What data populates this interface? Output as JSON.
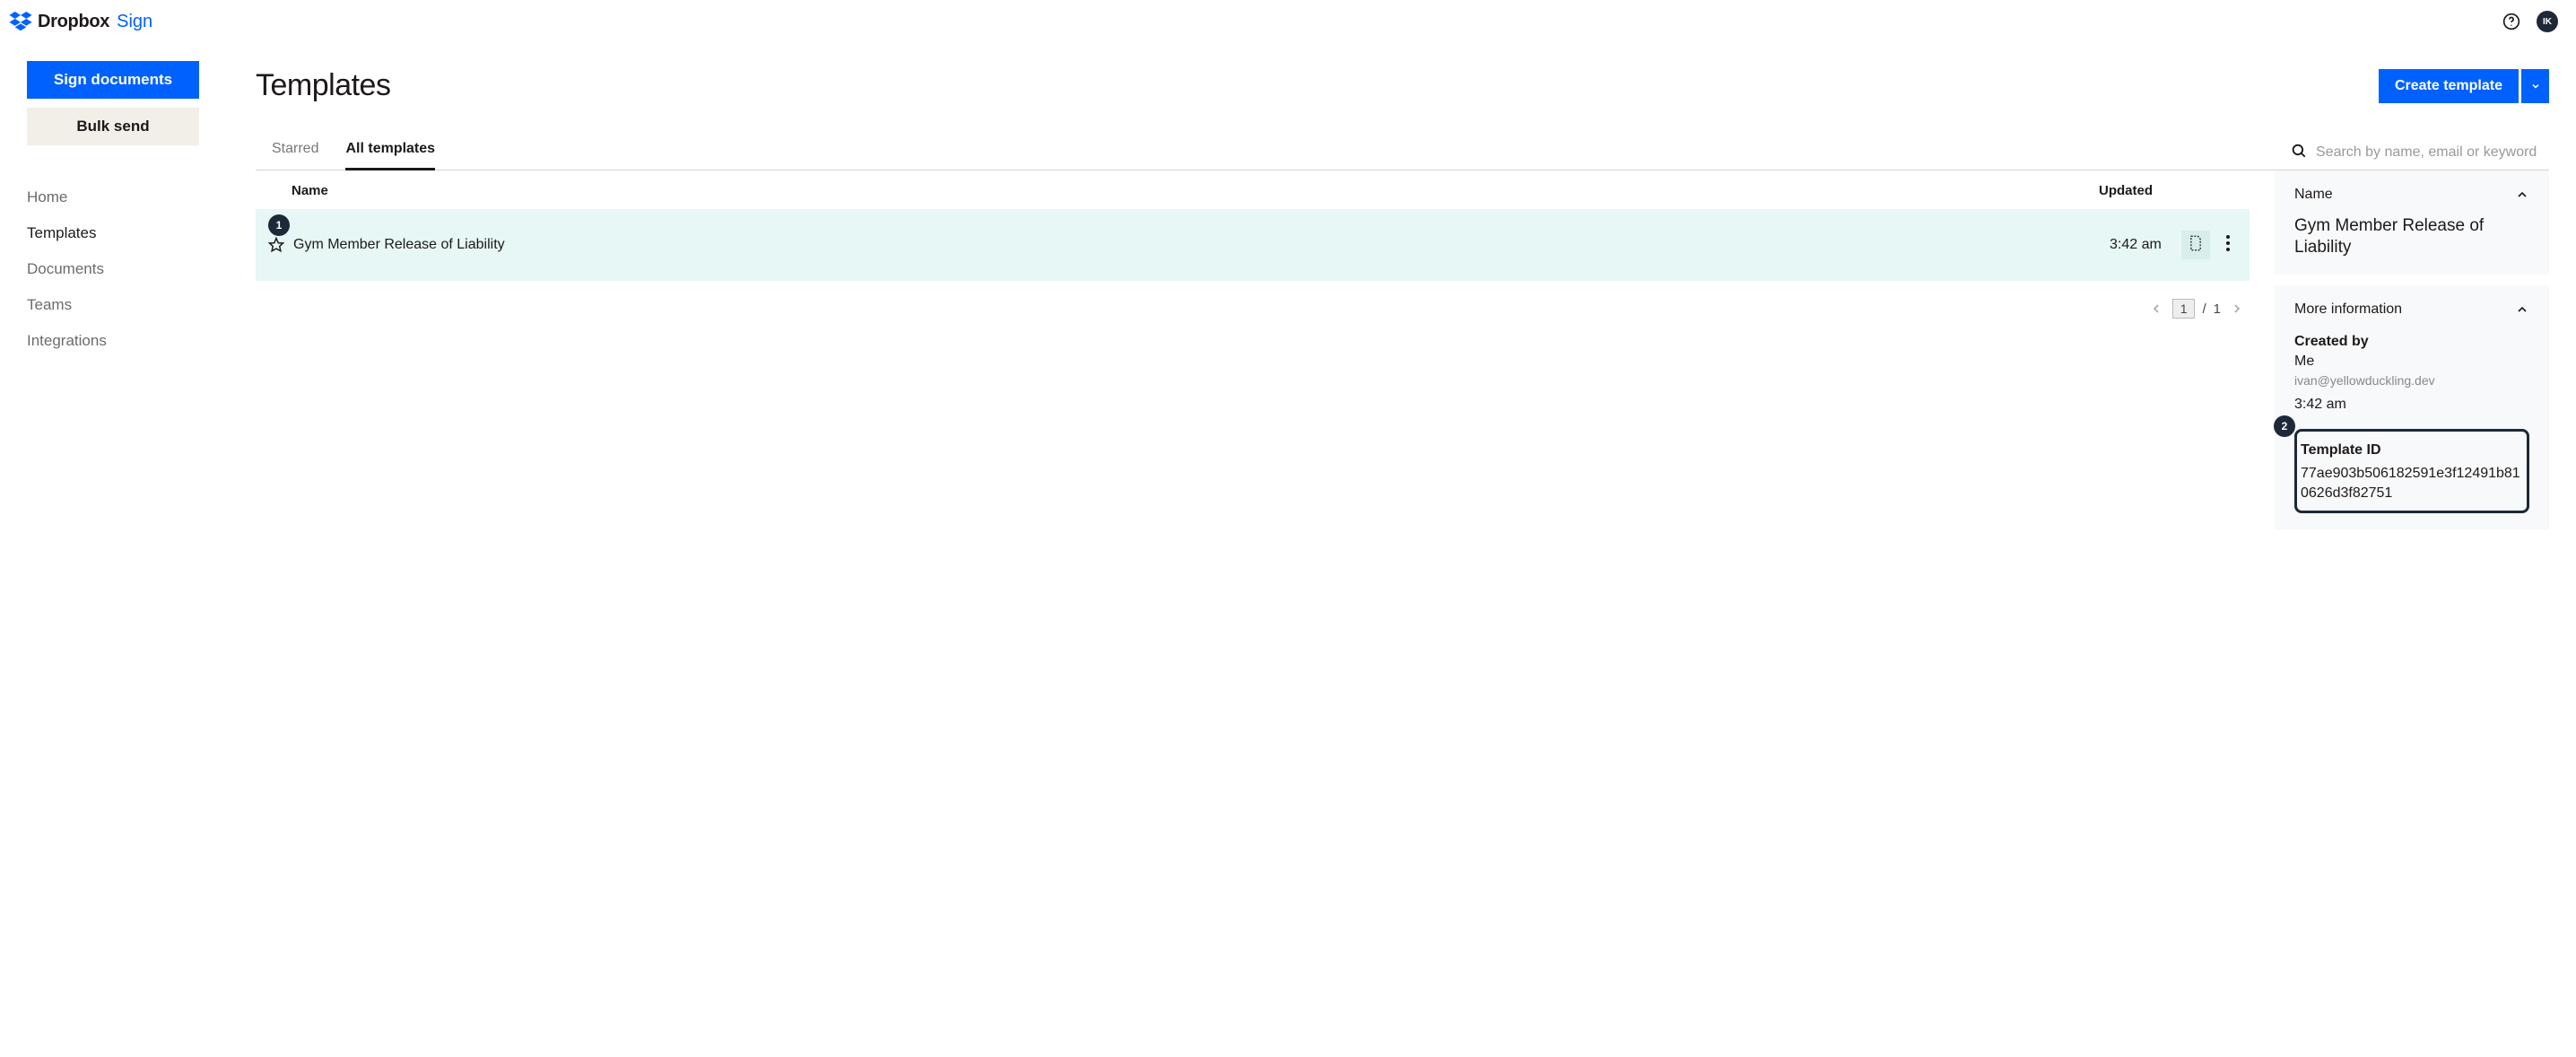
{
  "header": {
    "logo_primary": "Dropbox",
    "logo_secondary": "Sign",
    "avatar_initials": "IK"
  },
  "sidebar": {
    "sign_button": "Sign documents",
    "bulk_button": "Bulk send",
    "nav": {
      "home": "Home",
      "templates": "Templates",
      "documents": "Documents",
      "teams": "Teams",
      "integrations": "Integrations"
    }
  },
  "page": {
    "title": "Templates",
    "create_button": "Create template"
  },
  "tabs": {
    "starred": "Starred",
    "all": "All templates"
  },
  "search": {
    "placeholder": "Search by name, email or keyword"
  },
  "table": {
    "col_name": "Name",
    "col_updated": "Updated",
    "rows": [
      {
        "name": "Gym Member Release of Liability",
        "updated": "3:42 am"
      }
    ]
  },
  "pagination": {
    "current": "1",
    "sep": "/",
    "total": "1"
  },
  "detail": {
    "name_label": "Name",
    "name_value": "Gym Member Release of Liability",
    "more_label": "More information",
    "created_by_label": "Created by",
    "created_by_value": "Me",
    "created_by_email": "ivan@yellowduckling.dev",
    "created_time": "3:42 am",
    "template_id_label": "Template ID",
    "template_id_value": "77ae903b506182591e3f12491b810626d3f82751"
  },
  "callouts": {
    "step1": "1",
    "step2": "2"
  }
}
